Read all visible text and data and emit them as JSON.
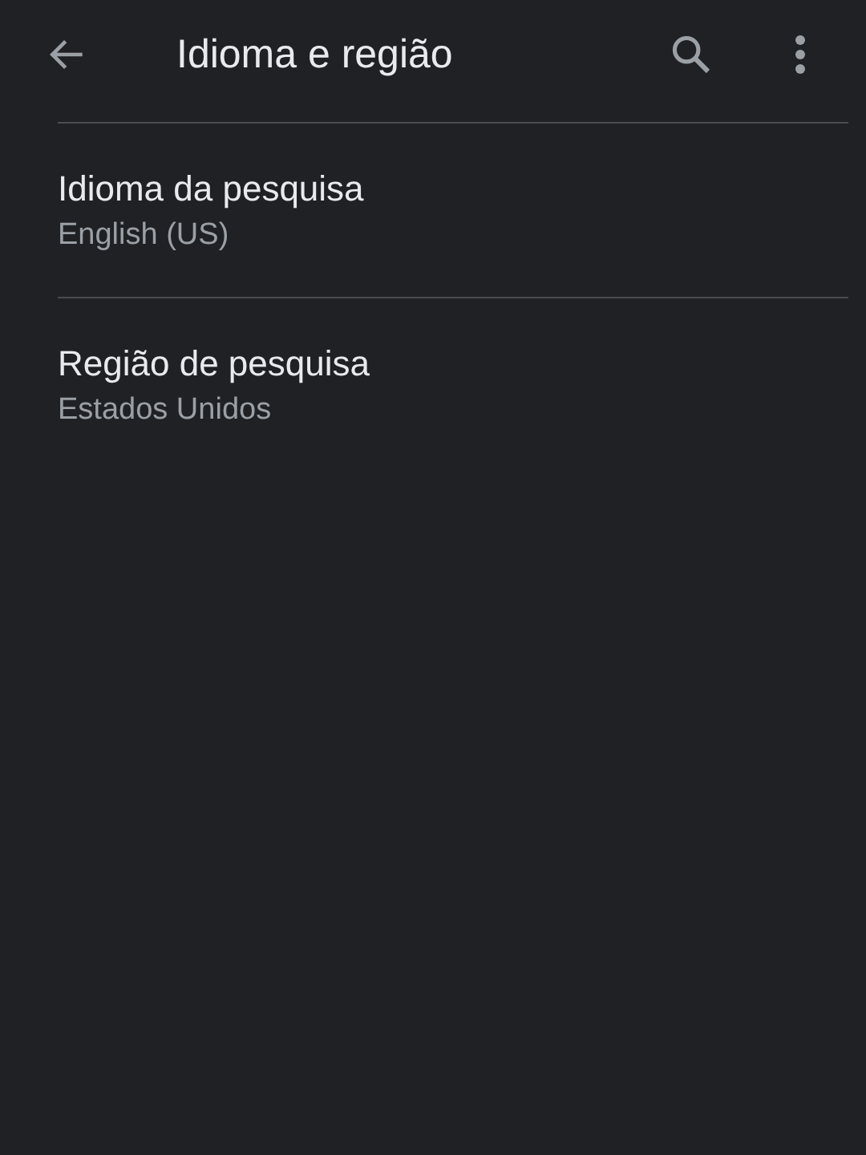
{
  "app_bar": {
    "title": "Idioma e região"
  },
  "settings": [
    {
      "title": "Idioma da pesquisa",
      "value": "English (US)"
    },
    {
      "title": "Região de pesquisa",
      "value": "Estados Unidos"
    }
  ]
}
